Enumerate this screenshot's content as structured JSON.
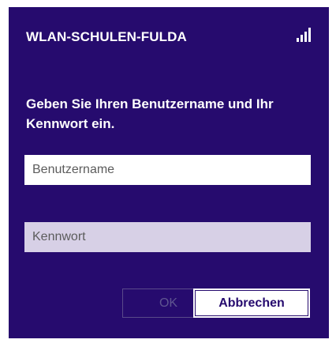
{
  "network": {
    "name": "WLAN-SCHULEN-FULDA",
    "signal_icon": "wifi-signal-icon"
  },
  "prompt": {
    "text": "Geben Sie Ihren Benutzername und Ihr Kennwort ein."
  },
  "fields": {
    "username": {
      "placeholder": "Benutzername",
      "value": ""
    },
    "password": {
      "placeholder": "Kennwort",
      "value": ""
    }
  },
  "buttons": {
    "ok_label": "OK",
    "cancel_label": "Abbrechen"
  },
  "colors": {
    "panel_background": "#260b6e",
    "text": "#ffffff",
    "password_field_background": "#d7d0e6",
    "ok_disabled_text": "#5f5590"
  }
}
